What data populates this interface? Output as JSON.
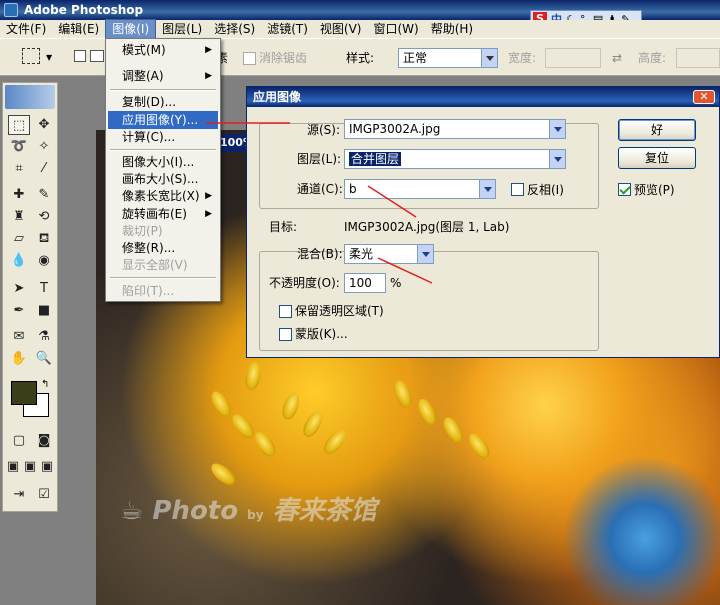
{
  "app": {
    "title": "Adobe Photoshop"
  },
  "ime": {
    "mode": "S",
    "lang": "中"
  },
  "menubar": [
    "文件(F)",
    "编辑(E)",
    "图像(I)",
    "图层(L)",
    "选择(S)",
    "滤镜(T)",
    "视图(V)",
    "窗口(W)",
    "帮助(H)"
  ],
  "options": {
    "partial_label": "素",
    "antialias_label": "消除锯齿",
    "style_label": "样式:",
    "style_value": "正常",
    "width_label": "宽度:",
    "height_label": "高度:"
  },
  "document": {
    "title_partial": "100%"
  },
  "image_menu": {
    "items": [
      {
        "label": "模式(M)",
        "arrow": "▶",
        "state": "normal"
      },
      {
        "label": "调整(A)",
        "arrow": "▶",
        "state": "normal"
      },
      {
        "label": "复制(D)...",
        "arrow": "",
        "state": "normal"
      },
      {
        "label": "应用图像(Y)...",
        "arrow": "",
        "state": "highlight"
      },
      {
        "label": "计算(C)...",
        "arrow": "",
        "state": "normal"
      },
      {
        "label": "图像大小(I)...",
        "arrow": "",
        "state": "normal"
      },
      {
        "label": "画布大小(S)...",
        "arrow": "",
        "state": "normal"
      },
      {
        "label": "像素长宽比(X)",
        "arrow": "▶",
        "state": "normal"
      },
      {
        "label": "旋转画布(E)",
        "arrow": "▶",
        "state": "normal"
      },
      {
        "label": "裁切(P)",
        "arrow": "",
        "state": "disabled"
      },
      {
        "label": "修整(R)...",
        "arrow": "",
        "state": "normal"
      },
      {
        "label": "显示全部(V)",
        "arrow": "",
        "state": "disabled"
      },
      {
        "label": "陷印(T)...",
        "arrow": "",
        "state": "disabled"
      }
    ]
  },
  "dialog": {
    "title": "应用图像",
    "source_label": "源(S):",
    "source_value": "IMGP3002A.jpg",
    "layer_label": "图层(L):",
    "layer_value": "合并图层",
    "channel_label": "通道(C):",
    "channel_value": "b",
    "invert_label": "反相(I)",
    "target_label": "目标:",
    "target_value": "IMGP3002A.jpg(图层 1, Lab)",
    "blend_label": "混合(B):",
    "blend_value": "柔光",
    "opacity_label": "不透明度(O):",
    "opacity_value": "100",
    "opacity_unit": "%",
    "preserve_label": "保留透明区域(T)",
    "mask_label": "蒙版(K)...",
    "ok_label": "好",
    "reset_label": "复位",
    "preview_label": "预览(P)",
    "preview_checked": true
  },
  "watermark": {
    "text": "Photo",
    "by": "by",
    "name": "春来茶馆"
  },
  "colors": {
    "titlebar": "#0a246a",
    "menu_highlight": "#316ac5",
    "annotation": "#e02020",
    "foreground": "#3a3f1a",
    "background": "#ffffff"
  }
}
